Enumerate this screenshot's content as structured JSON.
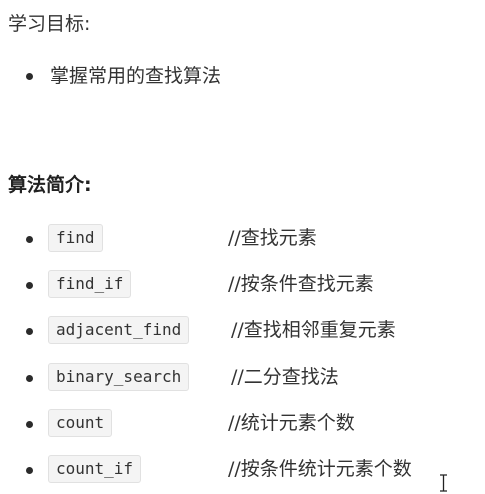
{
  "learning_goals": {
    "heading": "学习目标:",
    "items": [
      {
        "text": "掌握常用的查找算法"
      }
    ]
  },
  "algorithm_intro": {
    "heading": "算法简介:",
    "items": [
      {
        "code": "find",
        "comment": "//查找元素"
      },
      {
        "code": "find_if",
        "comment": "//按条件查找元素"
      },
      {
        "code": "adjacent_find",
        "comment": "//查找相邻重复元素"
      },
      {
        "code": "binary_search",
        "comment": "//二分查找法"
      },
      {
        "code": "count",
        "comment": "//统计元素个数"
      },
      {
        "code": "count_if",
        "comment": "//按条件统计元素个数"
      }
    ]
  },
  "icons": {
    "bullet": "bullet-dot-icon",
    "cursor": "text-cursor-icon"
  },
  "colors": {
    "text": "#333333",
    "code_background": "#f4f4f4",
    "code_border": "#e1e1e1"
  }
}
